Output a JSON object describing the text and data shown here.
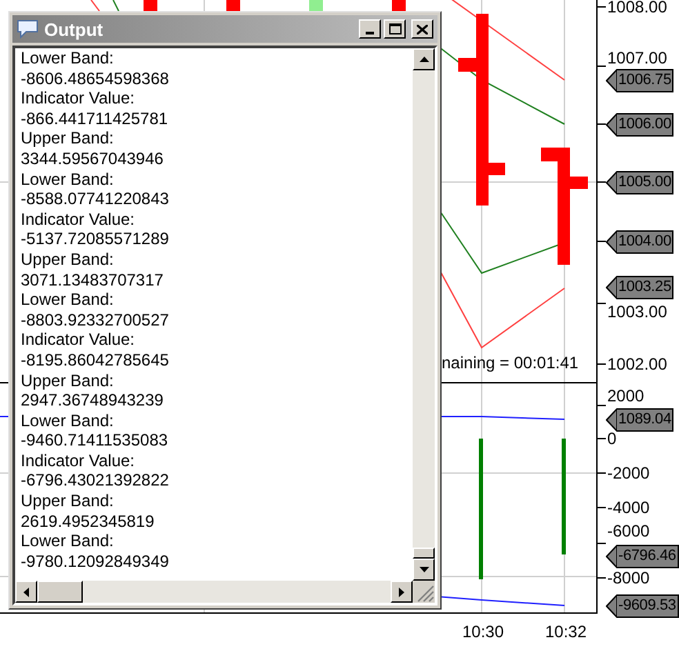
{
  "chart": {
    "price_axis_labels": [
      "1008.00",
      "1007.00",
      "1003.00",
      "1002.00"
    ],
    "price_tags": [
      "1006.75",
      "1006.00",
      "1005.00",
      "1004.00",
      "1003.25"
    ],
    "status_text": "naining = 00:01:41",
    "indicator_axis_labels": [
      "2000",
      "0",
      "-2000",
      "-4000",
      "-6000",
      "-8000"
    ],
    "indicator_tags": [
      "1089.04",
      "-6796.46",
      "-9609.53"
    ],
    "time_labels": [
      "10:30",
      "10:32"
    ]
  },
  "output_window": {
    "title": "Output",
    "lines": [
      "Lower Band:",
      "-8606.48654598368",
      "Indicator Value:",
      "-866.441711425781",
      "Upper Band:",
      "3344.59567043946",
      "Lower Band:",
      "-8588.07741220843",
      "Indicator Value:",
      "-5137.72085571289",
      "Upper Band:",
      "3071.13483707317",
      "Lower Band:",
      "-8803.92332700527",
      "Indicator Value:",
      "-8195.86042785645",
      "Upper Band:",
      "2947.36748943239",
      "Lower Band:",
      "-9460.71411535083",
      "Indicator Value:",
      "-6796.43021392822",
      "Upper Band:",
      "2619.4952345819",
      "Lower Band:",
      "-9780.12092849349"
    ]
  }
}
